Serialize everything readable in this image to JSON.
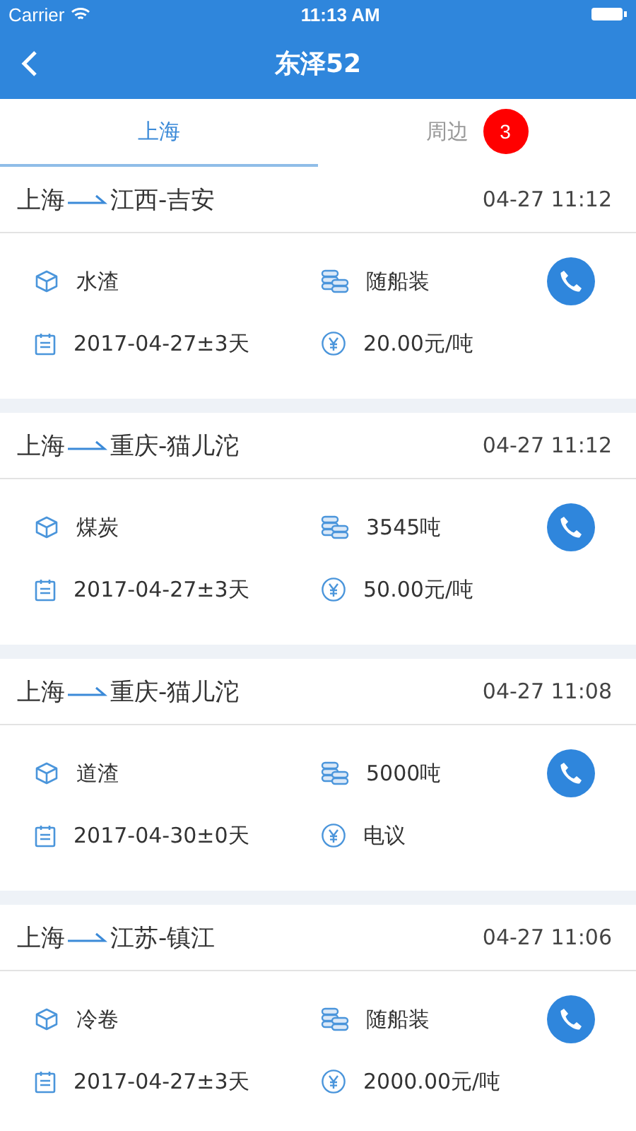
{
  "status_bar": {
    "carrier": "Carrier",
    "time": "11:13 AM"
  },
  "nav": {
    "title": "东泽52"
  },
  "tabs": [
    {
      "label": "上海",
      "selected": true
    },
    {
      "label": "周边",
      "selected": false,
      "badge": "3"
    }
  ],
  "cargo_list": [
    {
      "origin": "上海",
      "destination": "江西-吉安",
      "time": "04-27 11:12",
      "cargo": "水渣",
      "quantity": "随船装",
      "date": "2017-04-27±3天",
      "price": "20.00元/吨"
    },
    {
      "origin": "上海",
      "destination": "重庆-猫儿沱",
      "time": "04-27 11:12",
      "cargo": "煤炭",
      "quantity": "3545吨",
      "date": "2017-04-27±3天",
      "price": "50.00元/吨"
    },
    {
      "origin": "上海",
      "destination": "重庆-猫儿沱",
      "time": "04-27 11:08",
      "cargo": "道渣",
      "quantity": "5000吨",
      "date": "2017-04-30±0天",
      "price": "电议"
    },
    {
      "origin": "上海",
      "destination": "江苏-镇江",
      "time": "04-27 11:06",
      "cargo": "冷卷",
      "quantity": "随船装",
      "date": "2017-04-27±3天",
      "price": "2000.00元/吨"
    }
  ]
}
